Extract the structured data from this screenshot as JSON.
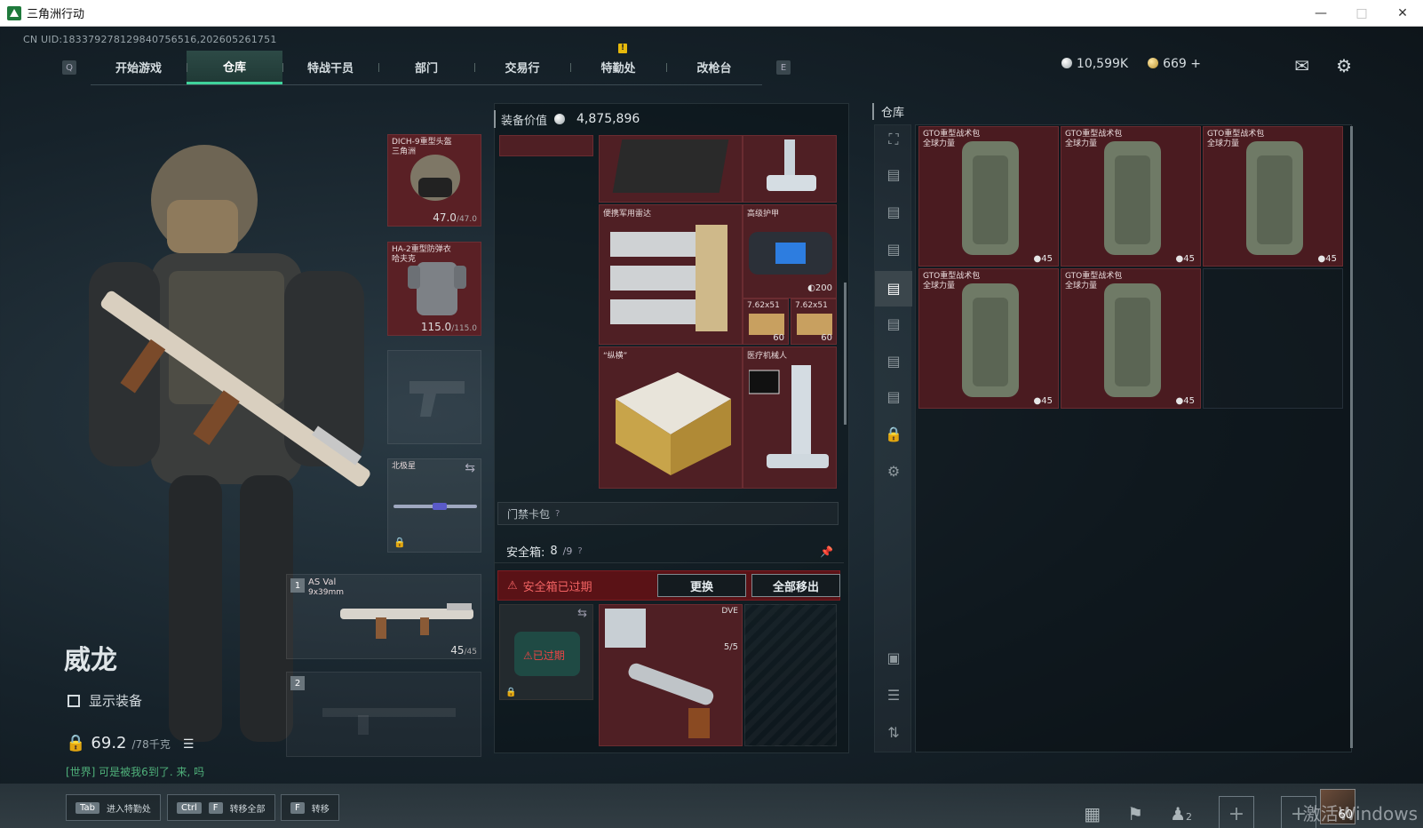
{
  "window": {
    "title": "三角洲行动"
  },
  "uid": "CN UID:18337927812984075651​6,202605261751",
  "nav": {
    "hint_left": "Q",
    "hint_right": "E",
    "tabs": [
      "开始游戏",
      "仓库",
      "特战干员",
      "部门",
      "交易行",
      "特勤处",
      "改枪台"
    ],
    "active_tab": "仓库",
    "notif_badge": "!"
  },
  "currency": {
    "silver": "10,599K",
    "gold": "669",
    "gold_plus": "+"
  },
  "operator": {
    "name": "威龙",
    "show_equipment": "显示装备",
    "weight_value": "69.2",
    "weight_max": "/78千克",
    "chat": "[世界] 可是被我6到了. 来, 吗"
  },
  "equipment": {
    "helmet": {
      "name": "DICH-9重型头盔",
      "sub": "三角洲",
      "durability": "47.0",
      "max": "/47.0"
    },
    "armor": {
      "name": "HA-2重型防弹衣",
      "sub": "哈夫克",
      "durability": "115.0",
      "max": "/115.0"
    },
    "melee": {
      "name": "北极星"
    },
    "primary": {
      "slot": "1",
      "name": "AS Val",
      "caliber": "9x39mm",
      "ammo": "45",
      "ammo_max": "/45"
    },
    "secondary": {
      "slot": "2"
    }
  },
  "center": {
    "equip_value_label": "装备价值",
    "equip_value": "4,875,896",
    "items": [
      {
        "name": "便携军用雷达"
      },
      {
        "name": "高级护甲"
      },
      {
        "name": "“纵横”"
      },
      {
        "name": "医疗机械人"
      },
      {
        "name": "7.62x51",
        "count": "60"
      },
      {
        "name": "7.62x51",
        "count": "60"
      },
      {
        "count": "200"
      }
    ],
    "keycard": "门禁卡包",
    "keycard_help": "?",
    "safebox_label": "安全箱:",
    "safebox_count": "8",
    "safebox_max": "/9",
    "safebox_help": "?",
    "safebox_expired": "安全箱已过期",
    "btn_replace": "更换",
    "btn_move_all": "全部移出",
    "expired_tag": "已过期",
    "slot_dura": "5/5",
    "slot_label": "DVE"
  },
  "warehouse": {
    "title": "仓库",
    "bags": [
      {
        "name": "GTO重型战术包",
        "sub": "全球力量",
        "count": "45"
      },
      {
        "name": "GTO重型战术包",
        "sub": "全球力量",
        "count": "45"
      },
      {
        "name": "GTO重型战术包",
        "sub": "全球力量",
        "count": "45"
      },
      {
        "name": "GTO重型战术包",
        "sub": "全球力量",
        "count": "45"
      },
      {
        "name": "GTO重型战术包",
        "sub": "全球力量",
        "count": "45"
      }
    ]
  },
  "bottom": {
    "hint1_key": "Tab",
    "hint1_label": "进入特勤处",
    "hint2_key1": "Ctrl",
    "hint2_key2": "F",
    "hint2_label": "转移全部",
    "hint3_key": "F",
    "hint3_label": "转移",
    "friends_count": "2",
    "avatar_level": "60",
    "watermark": "激活Windows"
  },
  "colors": {
    "accent": "#3fd39b",
    "item_red": "#4f1f24",
    "warning": "#e5b80b",
    "expired": "#f26363"
  }
}
